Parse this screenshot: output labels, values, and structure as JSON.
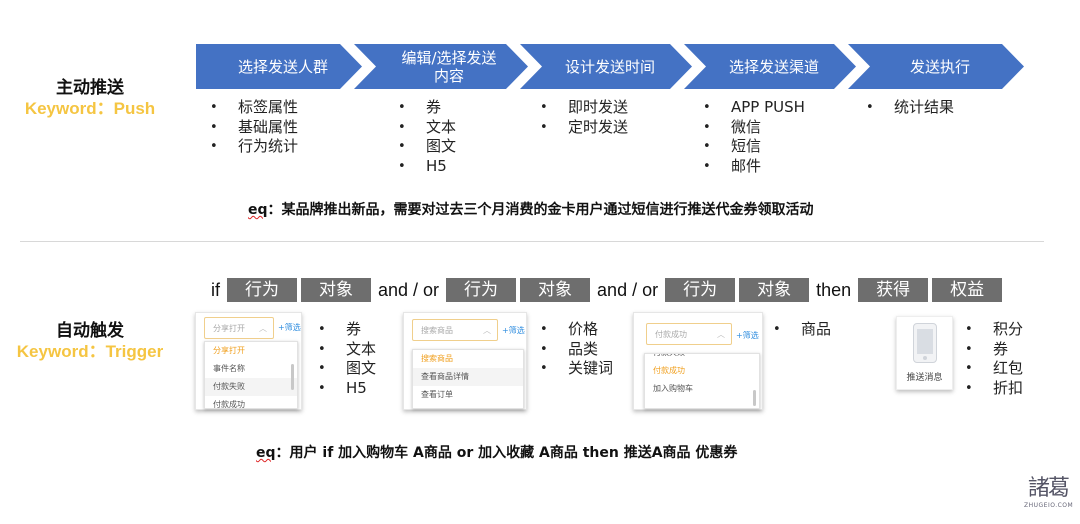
{
  "push_section": {
    "title": "主动推送",
    "keyword": "Keyword：Push",
    "steps": [
      {
        "label": "选择发送人群",
        "items": [
          "标签属性",
          "基础属性",
          "行为统计"
        ]
      },
      {
        "label": "编辑/选择发送内容",
        "label_line1": "编辑/选择发送",
        "label_line2": "内容",
        "items": [
          "券",
          "文本",
          "图文",
          "H5"
        ]
      },
      {
        "label": "设计发送时间",
        "items": [
          "即时发送",
          "定时发送"
        ]
      },
      {
        "label": "选择发送渠道",
        "items": [
          "APP PUSH",
          "微信",
          "短信",
          "邮件"
        ]
      },
      {
        "label": "发送执行",
        "items": [
          "统计结果"
        ]
      }
    ],
    "example_prefix": "eq",
    "example_text": "：某品牌推出新品，需要对过去三个月消费的金卡用户通过短信进行推送代金券领取活动"
  },
  "trigger_section": {
    "title": "自动触发",
    "keyword": "Keyword：Trigger",
    "rule": {
      "if": "if",
      "tag_behavior": "行为",
      "tag_object": "对象",
      "and_or": "and / or",
      "then": "then",
      "tag_obtain": "获得",
      "tag_rights": "权益"
    },
    "panels": [
      {
        "select_value": "分享打开",
        "filter_label": "+筛选",
        "options": [
          "分享打开",
          "事件名称",
          "付款失败",
          "付款成功"
        ],
        "active_option": "分享打开",
        "items": [
          "券",
          "文本",
          "图文",
          "H5"
        ]
      },
      {
        "select_value": "搜索商品",
        "filter_label": "+筛选",
        "options": [
          "搜索商品",
          "查看商品详情",
          "查看订单"
        ],
        "active_option": "搜索商品",
        "items": [
          "价格",
          "品类",
          "关键词"
        ]
      },
      {
        "select_value": "付款成功",
        "filter_label": "+筛选",
        "options": [
          "付款失败",
          "付款成功",
          "加入购物车"
        ],
        "active_option": "付款成功",
        "items": [
          "商品"
        ]
      }
    ],
    "push_card_label": "推送消息",
    "rewards": [
      "积分",
      "券",
      "红包",
      "折扣"
    ],
    "example_prefix": "eq",
    "example_text": "：用户 if 加入购物车 A商品 or 加入收藏 A商品 then 推送A商品 优惠券"
  },
  "logo": {
    "name": "諸葛",
    "sub": "ZHUGEIO.COM"
  },
  "colors": {
    "chevron": "#4472c4",
    "keyword": "#f5c542",
    "tag": "#6e6e6e",
    "active_option": "#f0a020",
    "filter_link": "#2f8ddf"
  }
}
